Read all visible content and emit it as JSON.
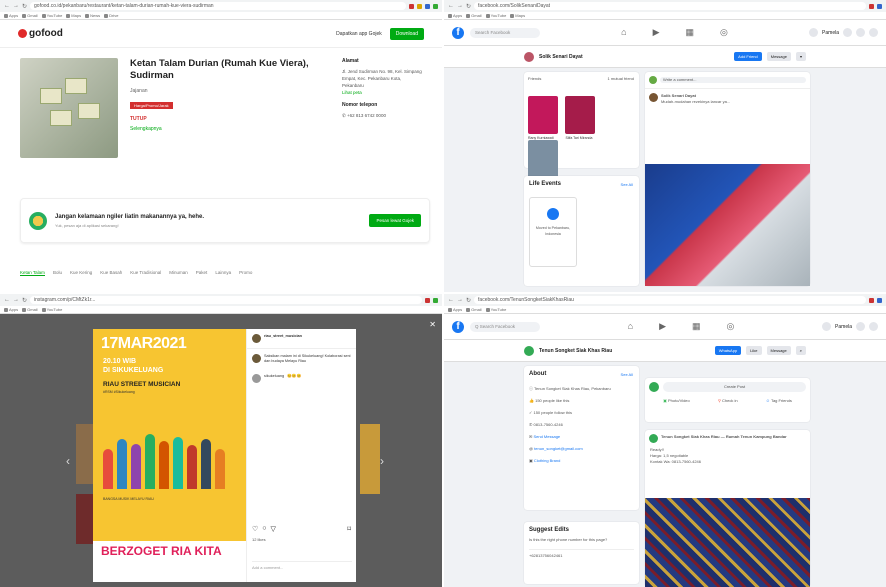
{
  "q1": {
    "url": "gofood.co.id/pekanbaru/restaurant/ketan-talam-durian-rumah-kue-viera-sudirman",
    "app_logo": "gofood",
    "header_link": "Dapatkan app Gojek",
    "header_button": "Download",
    "restaurant_title": "Ketan Talam Durian (Rumah Kue Viera), Sudirman",
    "category": "Jajanan",
    "tag": "Harga/Promo/Jarak",
    "status": "TUTUP",
    "more_link": "Selengkapnya",
    "address_heading": "Alamat",
    "address_text": "Jl. Jend Sudirman No. 98, Kel. Simpang Empat, Kec. Pekanbaru Kota, Pekanbaru",
    "map_link": "Lihat peta",
    "phone_heading": "Nomor telepon",
    "phone": "+62 813 6742 0000",
    "banner_title": "Jangan kelamaan ngiler liatin makanannya ya, hehe.",
    "banner_sub": "Yuk, pesan aja di aplikasi sekarang!",
    "banner_button": "Pesan lewat Gojek",
    "tabs": [
      "Ketan Talam",
      "Bolu",
      "Kue Kering",
      "Kue Basah",
      "Kue Tradisional",
      "Minuman",
      "Paket",
      "Lainnya",
      "Promo"
    ]
  },
  "q2": {
    "url": "facebook.com/SolikSenaniDayat",
    "search_placeholder": "Search Facebook",
    "user": "Pamela",
    "page_name": "Solik Senari Dayat",
    "btn_primary": "Add Friend",
    "btn_secondary": "Message",
    "friends_section_labels": [
      "Friends",
      "1 mutual friend"
    ],
    "friends": [
      "Rany Kurniawati",
      "Silfa Tari Miranda",
      "Haris Muhammad"
    ],
    "life_events": "Life Events",
    "see_all": "See All",
    "life_event_text": "Moved to Pekanbaru, Indonesia",
    "post_placeholder": "Write a comment...",
    "post_author": "Solik Senari Dayat",
    "post_caption": "Mudah-mudahan rezekinya lancar ya..."
  },
  "q3": {
    "url": "instagram.com/p/CMtZk1r...",
    "poster_date": "17MAR2021",
    "poster_time": "20.10 WIB",
    "poster_place": "DI SIKUKELUANG",
    "poster_band": "RIAU STREET MUSICIAN",
    "poster_yt": "#RSM #Sikukeluang",
    "poster_names": "BANGSA MUSIK MELAYU RIAU",
    "poster_title": "BERZOGET RIA KITA",
    "account": "riau_street_musician",
    "caption": "Saksikan malam ini di Sikukeluang! Kolaborasi seni dan budaya Melayu Riau",
    "comment_user": "sikukeluang",
    "likes": "12 likes",
    "add_comment": "Add a comment..."
  },
  "q4": {
    "url": "facebook.com/TenunSongketSiakKhasRiau",
    "search_placeholder": "Q Search Facebook",
    "user": "Pamela",
    "page_name": "Tenun Songket Siak Khas Riau",
    "btn_whatsapp": "WhatsApp",
    "btn_like": "Like",
    "btn_message": "Message",
    "about_heading": "About",
    "see_all": "See All",
    "about_items": [
      "Tenun Songket Siak Khas Riau, Pekanbaru",
      "150 people like this",
      "150 people follow this",
      "0813-7560-4246",
      "Send Message",
      "tenun_songket@gmail.com",
      "Clothing Brand"
    ],
    "suggest_heading": "Suggest Edits",
    "suggest_text": "Is this the right phone number for this page?",
    "suggest_phone": "+62813756042461",
    "create_post": "Create Post",
    "actions": [
      "Photo/Video",
      "Check in",
      "Tag Friends"
    ],
    "post_page": "Tenun Songket Siak Khas Riau — Rumah Tenun Kampung Bandar",
    "post_lines": [
      "Ready!!",
      "Harga: 1,5 negotiable",
      "Kontak Wa: 0813-7560-4246"
    ]
  }
}
